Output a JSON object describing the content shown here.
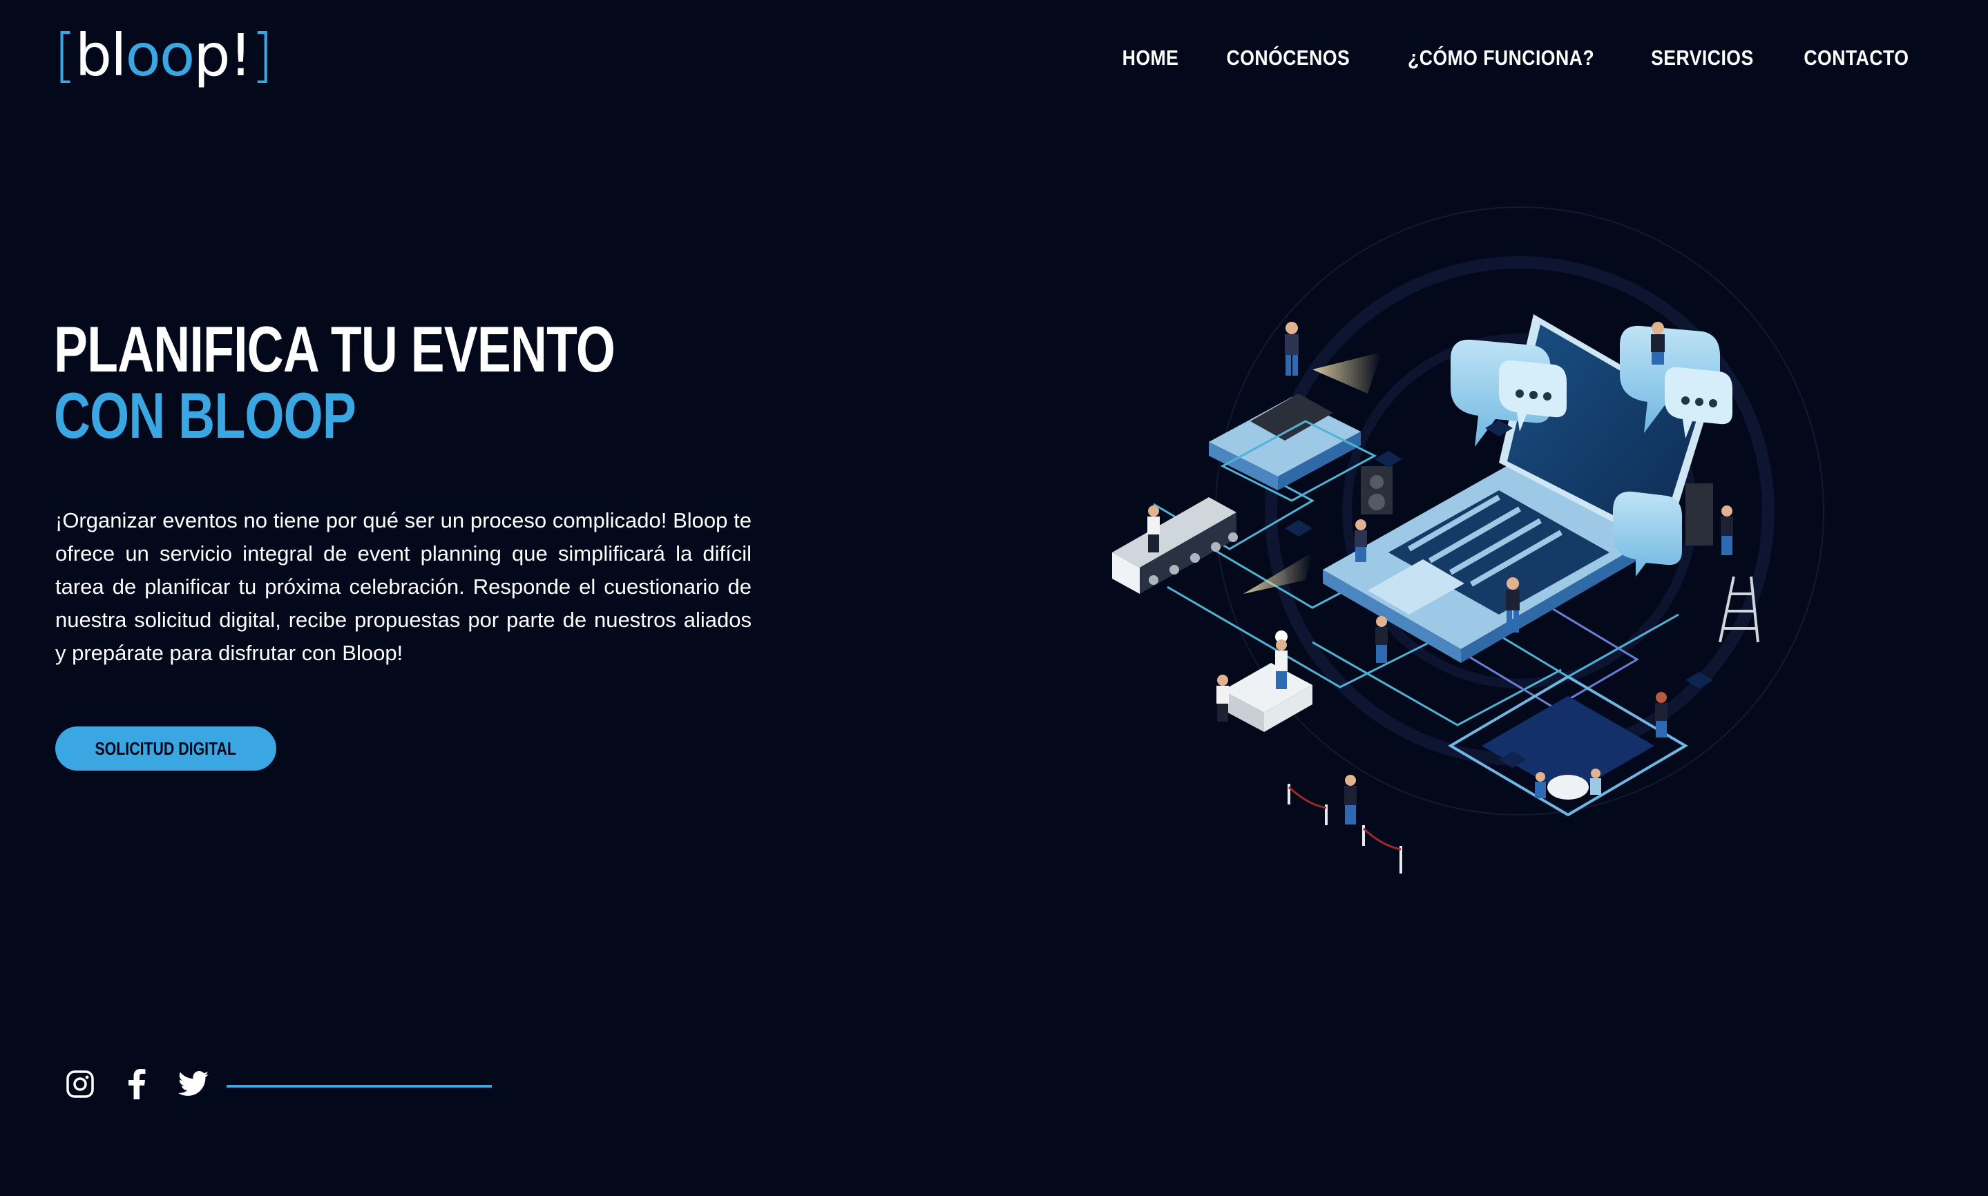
{
  "logo": {
    "open": "[",
    "part1": "bl",
    "part2": "oo",
    "part3": "p!",
    "close": "]"
  },
  "nav": {
    "items": [
      {
        "label": "HOME"
      },
      {
        "label": "CONÓCENOS"
      },
      {
        "label": "¿CÓMO FUNCIONA?"
      },
      {
        "label": "SERVICIOS"
      },
      {
        "label": "CONTACTO"
      }
    ]
  },
  "hero": {
    "title_line1": "PLANIFICA TU EVENTO",
    "title_line2": "CON BLOOP",
    "description": "¡Organizar eventos no tiene por qué ser un proceso complicado! Bloop te ofrece un servicio integral de event planning que simplificará la difícil tarea de planificar tu próxima celebración. Responde el cuestionario de nuestra solicitud digital, recibe propuestas por parte de nuestros aliados y prepárate para disfrutar con Bloop!",
    "cta_label": "SOLICITUD DIGITAL"
  },
  "social": {
    "icons": [
      "instagram-icon",
      "facebook-icon",
      "twitter-icon"
    ]
  },
  "colors": {
    "background": "#03081a",
    "accent": "#3aa6e2",
    "text": "#ffffff"
  }
}
